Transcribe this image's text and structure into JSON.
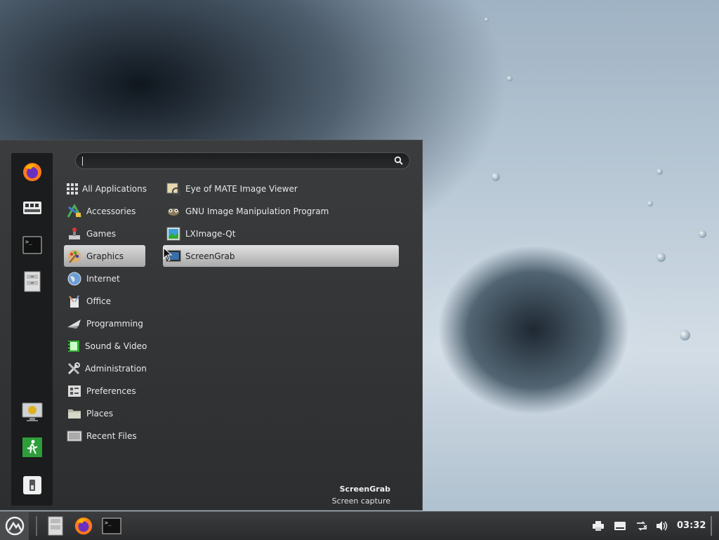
{
  "search": {
    "placeholder": "",
    "value": ""
  },
  "favorites": [
    {
      "name": "firefox-icon"
    },
    {
      "name": "software-manager-icon"
    },
    {
      "name": "terminal-icon"
    },
    {
      "name": "file-manager-icon"
    },
    {
      "name": "lock-screen-icon"
    },
    {
      "name": "logout-icon"
    },
    {
      "name": "shutdown-icon"
    }
  ],
  "categories": [
    {
      "label": "All Applications",
      "icon": "grid-icon"
    },
    {
      "label": "Accessories",
      "icon": "accessories-icon"
    },
    {
      "label": "Games",
      "icon": "games-icon"
    },
    {
      "label": "Graphics",
      "icon": "graphics-icon",
      "selected": true
    },
    {
      "label": "Internet",
      "icon": "globe-icon"
    },
    {
      "label": "Office",
      "icon": "office-icon"
    },
    {
      "label": "Programming",
      "icon": "programming-icon"
    },
    {
      "label": "Sound & Video",
      "icon": "sound-video-icon"
    },
    {
      "label": "Administration",
      "icon": "tools-icon"
    },
    {
      "label": "Preferences",
      "icon": "preferences-icon"
    },
    {
      "label": "Places",
      "icon": "folder-icon"
    },
    {
      "label": "Recent Files",
      "icon": "recent-files-icon"
    }
  ],
  "apps": [
    {
      "label": "Eye of MATE Image Viewer",
      "icon": "image-viewer-icon"
    },
    {
      "label": "GNU Image Manipulation Program",
      "icon": "gimp-icon"
    },
    {
      "label": "LXImage-Qt",
      "icon": "lximage-icon"
    },
    {
      "label": "ScreenGrab",
      "icon": "screengrab-icon",
      "selected": true
    }
  ],
  "description": {
    "name": "ScreenGrab",
    "text": "Screen capture"
  },
  "panel": {
    "launchers": [
      "file-manager-icon",
      "firefox-icon",
      "terminal-icon"
    ],
    "tray": [
      "printer-icon",
      "keyboard-icon",
      "network-icon",
      "volume-icon"
    ],
    "clock": "03:32"
  },
  "colors": {
    "menu_bg": "#2f3133",
    "selection": "#c4c4c4",
    "panel_bg": "#2f3031"
  }
}
